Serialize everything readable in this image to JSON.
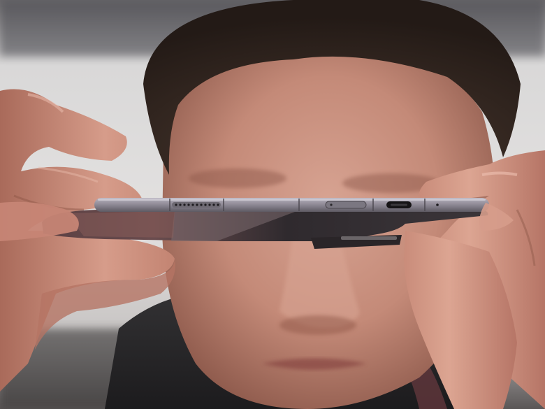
{
  "photo": {
    "subject": "",
    "colors": {
      "background_light": "#dedcdb",
      "background_dark": "#3a3838",
      "skin": "#c88e7c",
      "skin_shadow": "#8a5446",
      "hair": "#3a2c24",
      "phone_frame": "#8c8794",
      "phone_body": "#3a3437",
      "phone_glass": "#5a4a4c",
      "jacket": "#2a2a2c"
    },
    "objects": [
      "face",
      "hair",
      "left-hand",
      "right-hand",
      "folded-phone",
      "speaker-grille",
      "sim-tray",
      "usb-c-port",
      "hinge"
    ]
  }
}
